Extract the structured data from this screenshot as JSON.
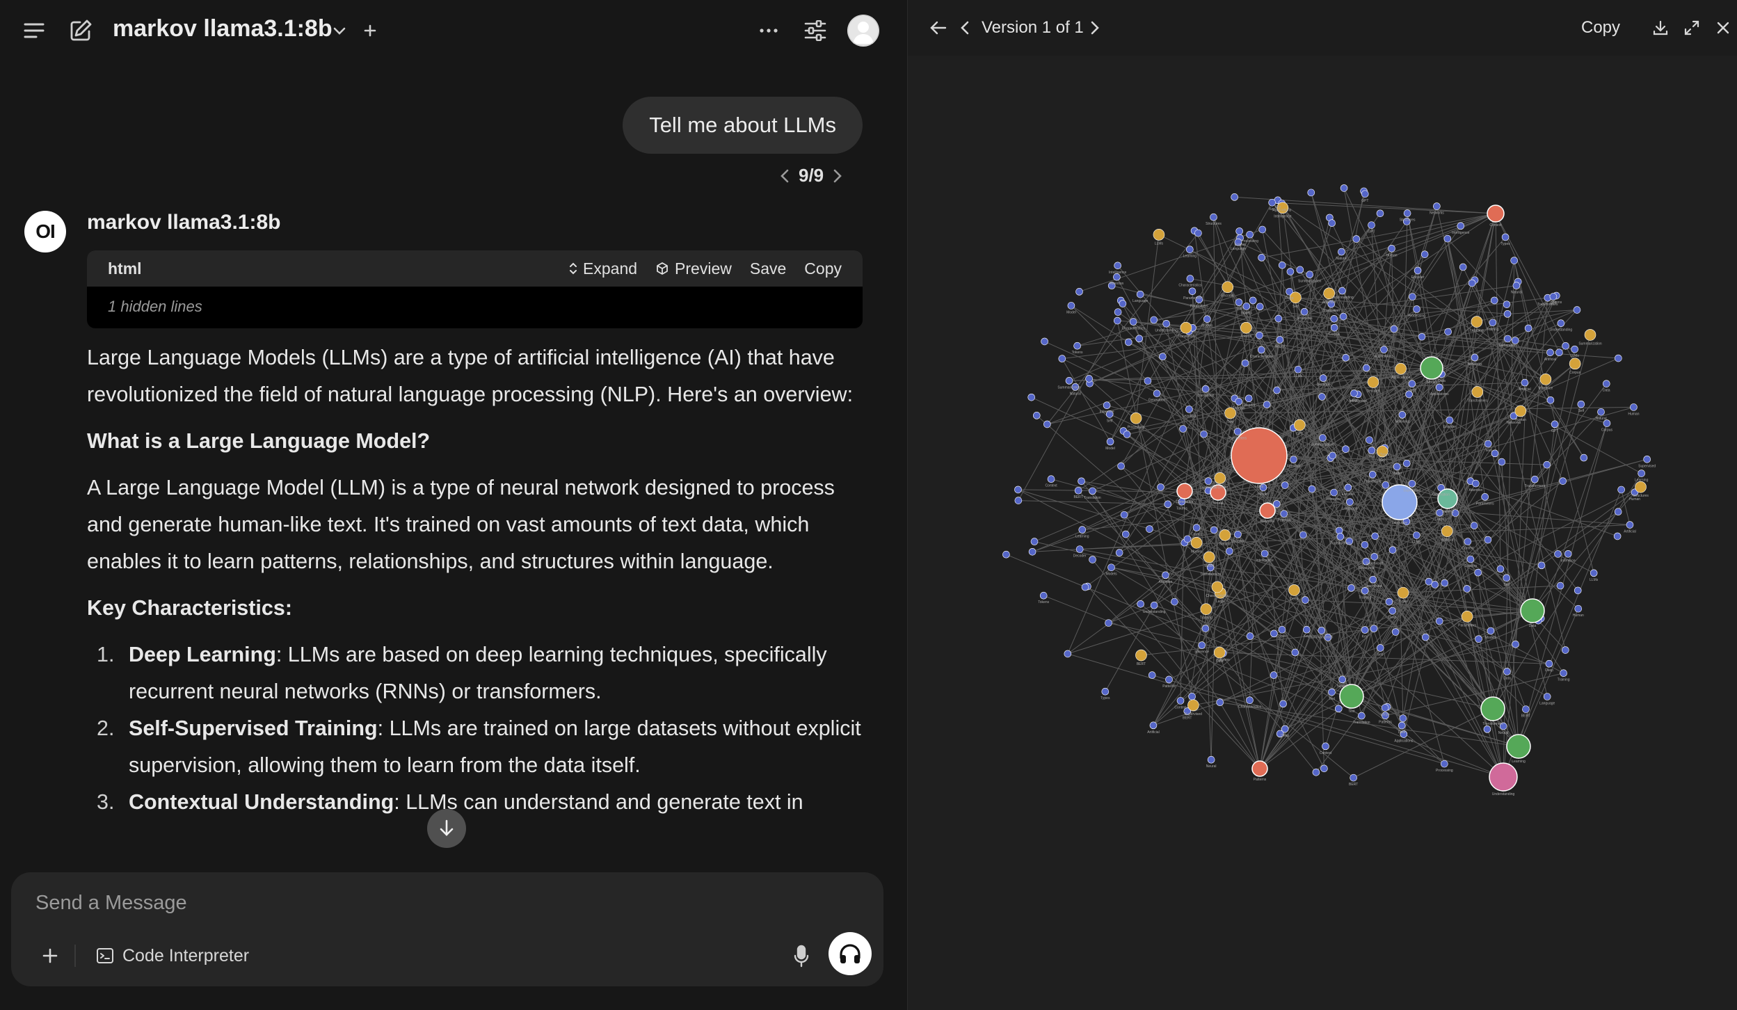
{
  "chat": {
    "header": {
      "model_title": "markov llama3.1:8b"
    },
    "user_message": "Tell me about LLMs",
    "pager": "9/9",
    "assistant": {
      "name": "markov llama3.1:8b",
      "logo_text": "OI",
      "code_block": {
        "language": "html",
        "expand_label": "Expand",
        "preview_label": "Preview",
        "save_label": "Save",
        "copy_label": "Copy",
        "hidden_lines": "1 hidden lines"
      },
      "intro": "Large Language Models (LLMs) are a type of artificial intelligence (AI) that have revolutionized the field of natural language processing (NLP). Here's an overview:",
      "heading_1": "What is a Large Language Model?",
      "para_1": "A Large Language Model (LLM) is a type of neural network designed to process and generate human-like text. It's trained on vast amounts of text data, which enables it to learn patterns, relationships, and structures within language.",
      "heading_2": "Key Characteristics:",
      "list": [
        {
          "num": "1.",
          "term": "Deep Learning",
          "text": ": LLMs are based on deep learning techniques, specifically recurrent neural networks (RNNs) or transformers."
        },
        {
          "num": "2.",
          "term": "Self-Supervised Training",
          "text": ": LLMs are trained on large datasets without explicit supervision, allowing them to learn from the data itself."
        },
        {
          "num": "3.",
          "term": "Contextual Understanding",
          "text": ": LLMs can understand and generate text in"
        }
      ]
    },
    "composer": {
      "placeholder": "Send a Message",
      "code_interpreter_label": "Code Interpreter"
    }
  },
  "artifact": {
    "version_label": "Version 1 of 1",
    "copy_label": "Copy",
    "graph": {
      "colors": {
        "blue": "#5566c8",
        "orange": "#e06c55",
        "gold": "#d4a23a",
        "green": "#55a858",
        "teal": "#6ab89a",
        "pink": "#d06a9a",
        "lightblue": "#8aa6e8"
      },
      "labels": [
        "LLMs",
        "Language",
        "Model",
        "Training",
        "Data",
        "Text",
        "Transformers",
        "Learning",
        "Understanding",
        "Context",
        "Networks",
        "Neural",
        "Generation",
        "Patterns",
        "Structures",
        "Deep",
        "Self",
        "Supervised",
        "Attention",
        "Encoder",
        "Decoder",
        "BERT",
        "GPT",
        "Tokens",
        "Corpus",
        "Parameters",
        "Inference",
        "Translation",
        "Summarization",
        "Characteristics",
        "Applications",
        "Types",
        "Models",
        "Human",
        "Intelligence",
        "Artificial",
        "Processing",
        "Natural",
        "Key",
        "Large"
      ]
    }
  }
}
